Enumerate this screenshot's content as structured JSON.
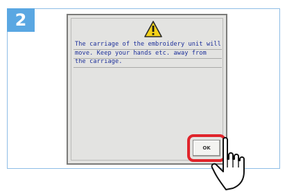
{
  "step": {
    "number": "2"
  },
  "dialog": {
    "icon": "warning-triangle-icon",
    "message_lines": [
      "The carriage of the embroidery unit will",
      "move. Keep your hands etc. away from",
      "the carriage."
    ],
    "ok_label": "OK"
  },
  "colors": {
    "badge": "#5aa7e2",
    "frame": "#8ebde6",
    "message_text": "#1c2f9a",
    "highlight": "#e0242b",
    "screen": "#e3e3e1"
  },
  "pointer": {
    "icon": "pointing-hand-icon"
  }
}
